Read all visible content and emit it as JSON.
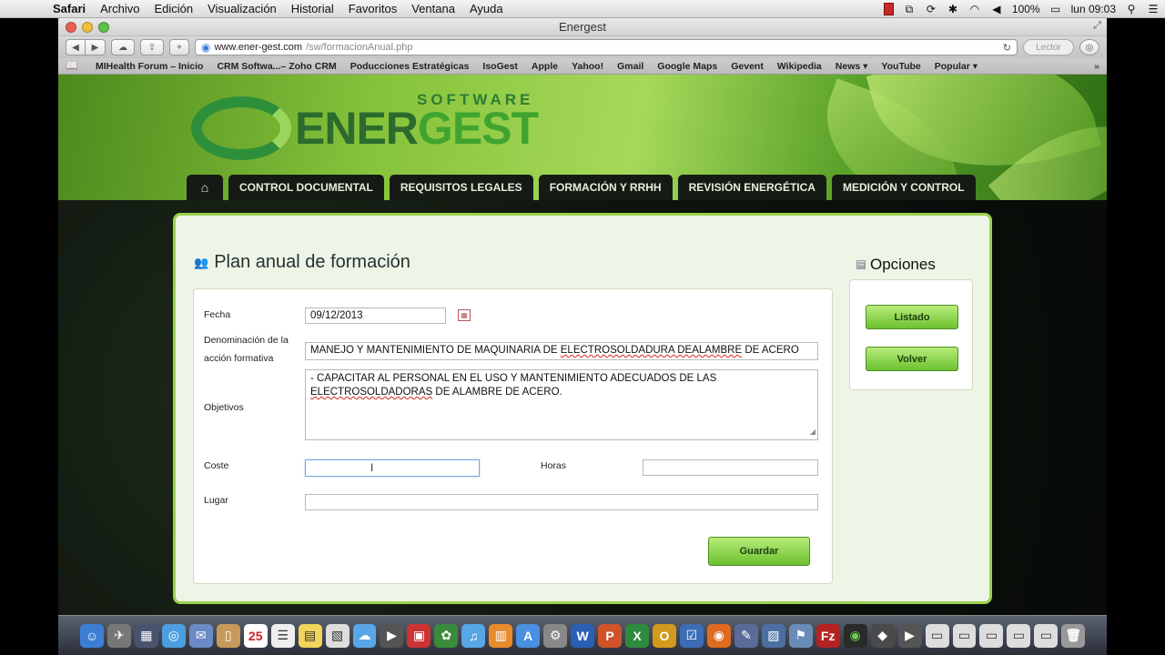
{
  "menubar": {
    "app": "Safari",
    "items": [
      "Archivo",
      "Edición",
      "Visualización",
      "Historial",
      "Favoritos",
      "Ventana",
      "Ayuda"
    ],
    "battery": "100%",
    "clock": "lun 09:03"
  },
  "window": {
    "title": "Energest"
  },
  "toolbar": {
    "url_host": "www.ener-gest.com",
    "url_path": "/sw/formacionAnual.php",
    "reader_label": "Lector"
  },
  "bookmarks": [
    "MIHealth Forum – Inicio",
    "CRM Softwa...– Zoho CRM",
    "Poducciones Estratégicas",
    "IsoGest",
    "Apple",
    "Yahoo!",
    "Gmail",
    "Google Maps",
    "Gevent",
    "Wikipedia",
    "News ▾",
    "YouTube",
    "Popular ▾"
  ],
  "logo": {
    "software": "SOFTWARE",
    "ener": "ENER",
    "gest": "GEST"
  },
  "nav": {
    "home_icon": "home-icon",
    "tabs": [
      "CONTROL DOCUMENTAL",
      "REQUISITOS LEGALES",
      "FORMACIÓN Y RRHH",
      "REVISIÓN ENERGÉTICA",
      "MEDICIÓN Y CONTROL"
    ]
  },
  "form": {
    "title": "Plan anual de formación",
    "fecha_label": "Fecha",
    "fecha_value": "09/12/2013",
    "denominacion_label_1": "Denominación de la",
    "denominacion_label_2": "acción formativa",
    "denominacion_pre": "MANEJO Y MANTENIMIENTO DE MAQUINARIA DE ",
    "denominacion_mid": "ELECTROSOLDADURA DEALAMBRE",
    "denominacion_post": " DE ACERO",
    "objetivos_label": "Objetivos",
    "objetivos_line1": "- CAPACITAR AL PERSONAL EN EL USO Y MANTENIMIENTO ADECUADOS DE LAS",
    "objetivos_line2_mark": "ELECTROSOLDADORAS",
    "objetivos_line2_rest": " DE ALAMBRE DE ACERO.",
    "coste_label": "Coste",
    "coste_value": "",
    "horas_label": "Horas",
    "horas_value": "",
    "lugar_label": "Lugar",
    "lugar_value": "",
    "save_label": "Guardar"
  },
  "opciones": {
    "title": "Opciones",
    "listado_label": "Listado",
    "volver_label": "Volver"
  },
  "colors": {
    "accent_green": "#9bd14d",
    "button_green": "#6bc12f",
    "nav_dark": "#151b14"
  }
}
